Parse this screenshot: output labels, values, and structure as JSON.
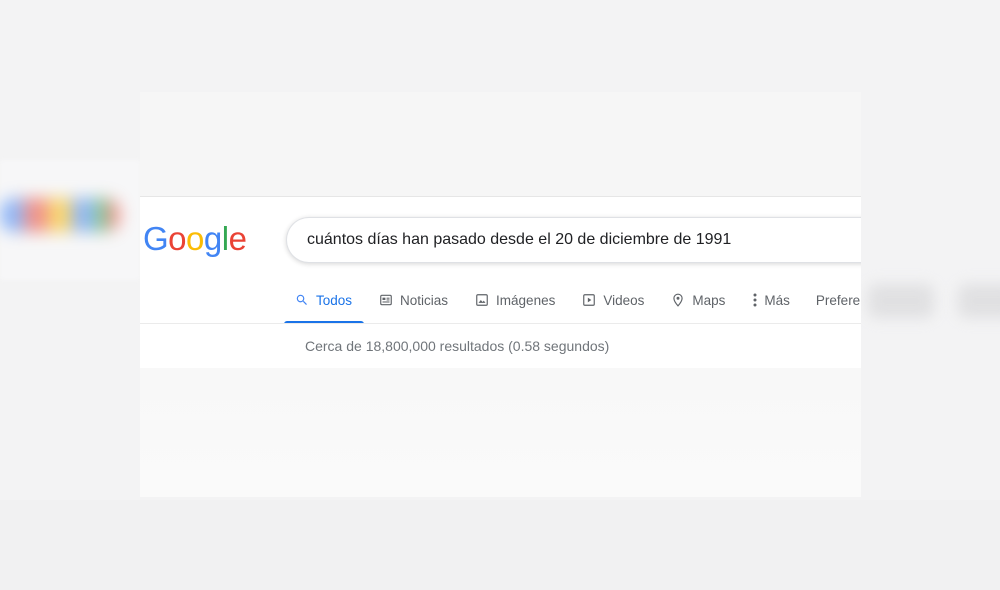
{
  "logo": {
    "letters": [
      "G",
      "o",
      "o",
      "g",
      "l",
      "e"
    ]
  },
  "search": {
    "value": "cuántos días han pasado desde el 20 de diciembre de 1991"
  },
  "tabs": [
    {
      "label": "Todos",
      "icon": "search-icon",
      "active": true
    },
    {
      "label": "Noticias",
      "icon": "news-icon",
      "active": false
    },
    {
      "label": "Imágenes",
      "icon": "image-icon",
      "active": false
    },
    {
      "label": "Videos",
      "icon": "play-icon",
      "active": false
    },
    {
      "label": "Maps",
      "icon": "map-pin-icon",
      "active": false
    },
    {
      "label": "Más",
      "icon": "more-vert-icon",
      "active": false
    },
    {
      "label": "Prefere",
      "icon": "",
      "active": false
    }
  ],
  "results_stats": "Cerca de 18,800,000 resultados (0.58 segundos)",
  "colors": {
    "google_blue": "#4285f4",
    "google_red": "#ea4335",
    "google_yellow": "#fbbc05",
    "google_green": "#34a853",
    "active_tab": "#1a73e8",
    "muted_text": "#5f6368"
  }
}
